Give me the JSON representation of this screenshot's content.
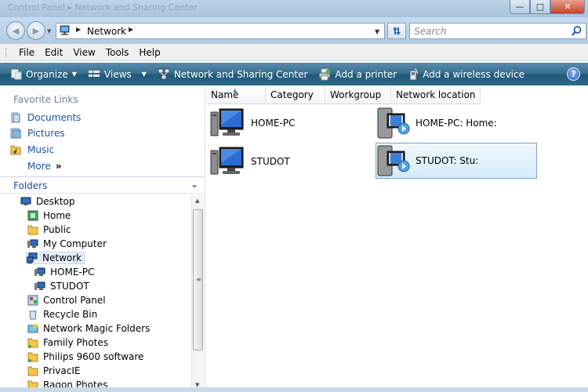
{
  "window": {
    "title": "Control Panel ▸ Network and Sharing Center",
    "buttons": {
      "minimize": "—",
      "maximize": "□",
      "close": "✕"
    }
  },
  "address": {
    "crumb": "Network",
    "search_placeholder": "Search"
  },
  "menu": [
    "File",
    "Edit",
    "View",
    "Tools",
    "Help"
  ],
  "commands": {
    "organize": "Organize",
    "views": "Views",
    "network_center": "Network and Sharing Center",
    "add_printer": "Add a printer",
    "add_wireless": "Add a wireless device",
    "help": "?"
  },
  "favorites": {
    "title": "Favorite Links",
    "items": [
      "Documents",
      "Pictures",
      "Music"
    ],
    "more": "More",
    "more_chevron": "»"
  },
  "folders": {
    "title": "Folders",
    "tree": [
      "Desktop",
      "Home",
      "Public",
      "My Computer",
      "Network",
      "HOME-PC",
      "STUDOT",
      "Control Panel",
      "Recycle Bin",
      "Network Magic Folders",
      "Family Photes",
      "Philips 9600 software",
      "PrivacIE",
      "Ragon Photes"
    ]
  },
  "columns": [
    "Name",
    "Category",
    "Workgroup",
    "Network location"
  ],
  "items": [
    {
      "label": "HOME-PC",
      "kind": "computer"
    },
    {
      "label": "HOME-PC: Home:",
      "kind": "media"
    },
    {
      "label": "STUDOT",
      "kind": "computer"
    },
    {
      "label": "STUDOT: Stu:",
      "kind": "media"
    }
  ],
  "colors": {
    "command_bar": "#2f6a8b",
    "link_blue": "#1a50a8",
    "selection": "#d5ebfb"
  }
}
